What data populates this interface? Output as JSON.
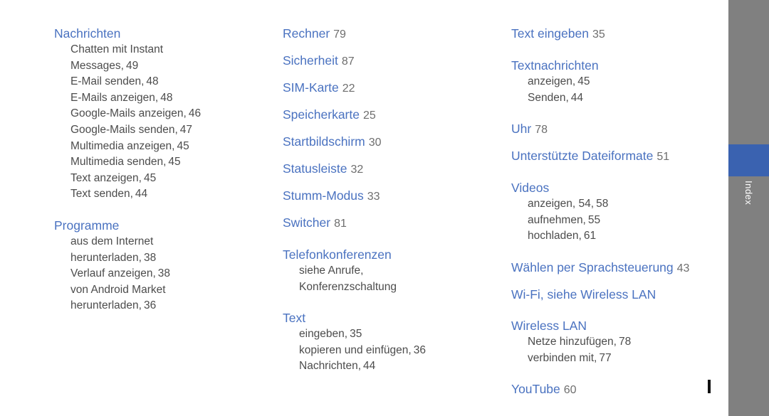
{
  "document": {
    "title": "Index",
    "colors": {
      "heading": "#4a72c0",
      "body": "#4c4c4c",
      "page_number": "#6e6e6e",
      "sidebar": "#808080",
      "sidebar_active": "#3a62b0",
      "background": "#ffffff"
    }
  },
  "sidebar": {
    "tab_label": "Index"
  },
  "columns": [
    {
      "id": "column-1",
      "groups": [
        {
          "heading": "Nachrichten",
          "page": "",
          "subs": [
            {
              "text": "Chatten mit Instant",
              "page": ""
            },
            {
              "text": "Messages,",
              "page": "49"
            },
            {
              "text": "E-Mail senden,",
              "page": "48"
            },
            {
              "text": "E-Mails anzeigen,",
              "page": "48"
            },
            {
              "text": "Google-Mails anzeigen,",
              "page": "46"
            },
            {
              "text": "Google-Mails senden,",
              "page": "47"
            },
            {
              "text": "Multimedia anzeigen,",
              "page": "45"
            },
            {
              "text": "Multimedia senden,",
              "page": "45"
            },
            {
              "text": "Text anzeigen,",
              "page": "45"
            },
            {
              "text": "Text senden,",
              "page": "44"
            }
          ]
        },
        {
          "heading": "Programme",
          "page": "",
          "subs": [
            {
              "text": "aus dem Internet",
              "page": ""
            },
            {
              "text": "herunterladen,",
              "page": "38"
            },
            {
              "text": "Verlauf anzeigen,",
              "page": "38"
            },
            {
              "text": "von Android Market",
              "page": ""
            },
            {
              "text": "herunterladen,",
              "page": "36"
            }
          ]
        }
      ]
    },
    {
      "id": "column-2",
      "groups": [
        {
          "heading": "Rechner",
          "page": "79",
          "subs": []
        },
        {
          "heading": "Sicherheit",
          "page": "87",
          "subs": []
        },
        {
          "heading": "SIM-Karte",
          "page": "22",
          "subs": []
        },
        {
          "heading": "Speicherkarte",
          "page": "25",
          "subs": []
        },
        {
          "heading": "Startbildschirm",
          "page": "30",
          "subs": []
        },
        {
          "heading": "Statusleiste",
          "page": "32",
          "subs": []
        },
        {
          "heading": "Stumm-Modus",
          "page": "33",
          "subs": []
        },
        {
          "heading": "Switcher",
          "page": "81",
          "subs": []
        },
        {
          "heading": "Telefonkonferenzen",
          "page": "",
          "subs": [
            {
              "text": "siehe Anrufe,",
              "page": ""
            },
            {
              "text": "Konferenzschaltung",
              "page": ""
            }
          ]
        },
        {
          "heading": "Text",
          "page": "",
          "subs": [
            {
              "text": "eingeben,",
              "page": "35"
            },
            {
              "text": "kopieren und einfügen,",
              "page": "36"
            },
            {
              "text": "Nachrichten,",
              "page": "44"
            }
          ]
        }
      ]
    },
    {
      "id": "column-3",
      "groups": [
        {
          "heading": "Text eingeben",
          "page": "35",
          "subs": []
        },
        {
          "heading": "Textnachrichten",
          "page": "",
          "subs": [
            {
              "text": "anzeigen,",
              "page": "45"
            },
            {
              "text": "Senden,",
              "page": "44"
            }
          ]
        },
        {
          "heading": "Uhr",
          "page": "78",
          "subs": []
        },
        {
          "heading": "Unterstützte Dateiformate",
          "page": "51",
          "subs": []
        },
        {
          "heading": "Videos",
          "page": "",
          "subs": [
            {
              "text": "anzeigen, 54,",
              "page": "58"
            },
            {
              "text": "aufnehmen,",
              "page": "55"
            },
            {
              "text": "hochladen,",
              "page": "61"
            }
          ]
        },
        {
          "heading": "Wählen per Sprachsteuerung",
          "page": "43",
          "subs": []
        },
        {
          "heading": "Wi-Fi, siehe Wireless LAN",
          "page": "",
          "subs": []
        },
        {
          "heading": "Wireless LAN",
          "page": "",
          "subs": [
            {
              "text": "Netze hinzufügen,",
              "page": "78"
            },
            {
              "text": "verbinden mit,",
              "page": "77"
            }
          ]
        },
        {
          "heading": "YouTube",
          "page": "60",
          "subs": []
        }
      ]
    }
  ]
}
